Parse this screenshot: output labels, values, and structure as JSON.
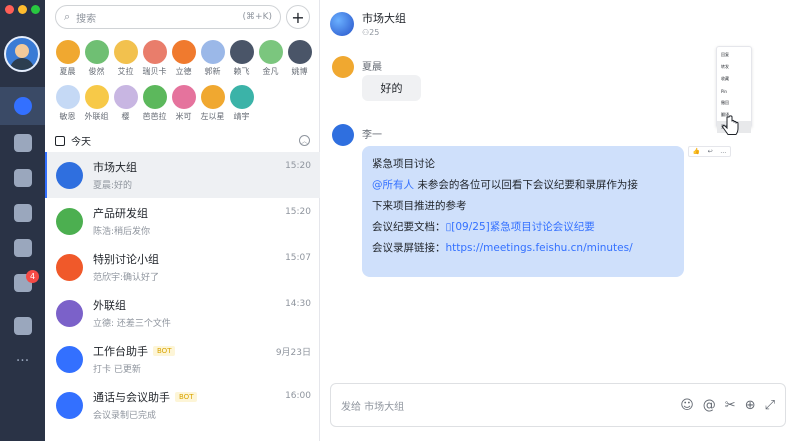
{
  "search": {
    "placeholder": "搜索",
    "shortcut": "(⌘+K)"
  },
  "contacts": [
    {
      "name": "夏晨",
      "color": "#f0a830"
    },
    {
      "name": "俊然",
      "color": "#6fbf73"
    },
    {
      "name": "艾拉",
      "color": "#f2c14e"
    },
    {
      "name": "瑞贝卡",
      "color": "#e97d6b"
    },
    {
      "name": "立德",
      "color": "#f07a2e"
    },
    {
      "name": "郭新",
      "color": "#9bb8e8"
    },
    {
      "name": "赖飞",
      "color": "#4a5568"
    },
    {
      "name": "金凡",
      "color": "#7bc67e"
    },
    {
      "name": "姚博",
      "color": "#4a5568"
    },
    {
      "name": "敏恩",
      "color": "#c5d9f5"
    },
    {
      "name": "外联组",
      "color": "#f7c948"
    },
    {
      "name": "樱",
      "color": "#c8b6e2"
    },
    {
      "name": "芭芭拉",
      "color": "#5cb85c"
    },
    {
      "name": "米可",
      "color": "#e5739d"
    },
    {
      "name": "左以星",
      "color": "#f0a830"
    },
    {
      "name": "靖宇",
      "color": "#3bb3a8"
    }
  ],
  "today_label": "今天",
  "conversations": [
    {
      "name": "市场大组",
      "preview": "夏晨:好的",
      "time": "15:20",
      "color": "#2f6fdf",
      "bot": ""
    },
    {
      "name": "产品研发组",
      "preview": "陈浩:稍后发你",
      "time": "15:20",
      "color": "#4caf50",
      "bot": ""
    },
    {
      "name": "特别讨论小组",
      "preview": "范欣宇:确认好了",
      "time": "15:07",
      "color": "#f0592a",
      "bot": ""
    },
    {
      "name": "外联组",
      "preview": "立德: 还差三个文件",
      "time": "14:30",
      "color": "#7b61c9",
      "bot": ""
    },
    {
      "name": "工作台助手",
      "preview": "打卡 已更新",
      "time": "9月23日",
      "color": "#3370ff",
      "bot": "BOT"
    },
    {
      "name": "通话与会议助手",
      "preview": "会议录制已完成",
      "time": "16:00",
      "color": "#3370ff",
      "bot": "BOT"
    }
  ],
  "chat": {
    "title": "市场大组",
    "members": "25",
    "msg1": {
      "sender": "夏晨",
      "text": "好的"
    },
    "msg2": {
      "sender": "李一",
      "title": "紧急项目讨论",
      "mention": "@所有人",
      "body1": " 未参会的各位可以回看下会议纪要和录屏作为接",
      "body2": "下来项目推进的参考",
      "doc_label": "会议纪要文档：",
      "doc_link": "[09/25]紧急项目讨论会议纪要",
      "rec_label": "会议录屏链接：",
      "rec_link": "https://meetings.feishu.cn/minutes/"
    },
    "menu": [
      "回复",
      "转发",
      "收藏",
      "Pin",
      "撤回",
      "翻译",
      "更多"
    ],
    "composer_placeholder": "发给 市场大组"
  },
  "rail_badge": "4"
}
